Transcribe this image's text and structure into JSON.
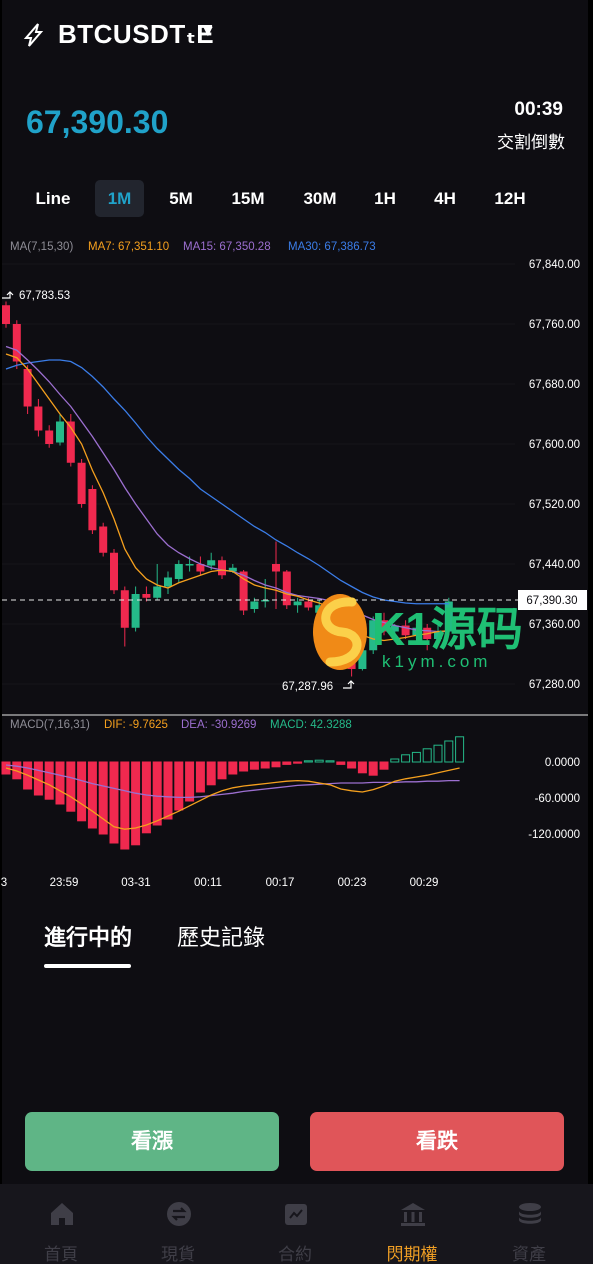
{
  "header": {
    "pair": "BTCUSDTₜE",
    "caret": "▼",
    "price": "67,390.30",
    "countdown": "00:39",
    "countdown_label": "交割倒數"
  },
  "intervals": [
    "Line",
    "1M",
    "5M",
    "15M",
    "30M",
    "1H",
    "4H",
    "12H"
  ],
  "active_interval": "1M",
  "chart": {
    "ma_legend": {
      "label": "MA(7,15,30)",
      "ma7": "MA7: 67,351.10",
      "ma15": "MA15: 67,350.28",
      "ma30": "MA30: 67,386.73"
    },
    "price_axis": [
      "67,840.00",
      "67,760.00",
      "67,680.00",
      "67,600.00",
      "67,520.00",
      "67,440.00",
      "67,360.00",
      "67,280.00"
    ],
    "current_price_tag": "67,390.30",
    "high_label": "67,783.53",
    "low_label": "67,287.96",
    "macd_legend": {
      "label": "MACD(7,16,31)",
      "dif": "DIF: -9.7625",
      "dea": "DEA: -30.9269",
      "macd": "MACD: 42.3288"
    },
    "macd_axis": [
      "0.0000",
      "-60.0000",
      "-120.0000"
    ],
    "time_axis": [
      "3",
      "23:59",
      "03-31",
      "00:11",
      "00:17",
      "00:23",
      "00:29"
    ],
    "watermark": {
      "text": "K1源码",
      "sub": "k1ym.com"
    },
    "colors": {
      "up": "#25b989",
      "down": "#f0294f",
      "ma7": "#f5a01e",
      "ma15": "#9c6fd0",
      "ma30": "#3b7de8"
    }
  },
  "chart_data": {
    "type": "candlestick",
    "y_range": [
      67260,
      67860
    ],
    "candles": [
      {
        "o": 67785,
        "h": 67790,
        "c": 67760,
        "l": 67755
      },
      {
        "o": 67760,
        "h": 67765,
        "c": 67710,
        "l": 67700
      },
      {
        "o": 67700,
        "h": 67705,
        "c": 67650,
        "l": 67640
      },
      {
        "o": 67650,
        "h": 67660,
        "c": 67618,
        "l": 67610
      },
      {
        "o": 67618,
        "h": 67625,
        "c": 67600,
        "l": 67595
      },
      {
        "o": 67602,
        "h": 67640,
        "c": 67630,
        "l": 67598
      },
      {
        "o": 67630,
        "h": 67640,
        "c": 67575,
        "l": 67570
      },
      {
        "o": 67575,
        "h": 67580,
        "c": 67520,
        "l": 67515
      },
      {
        "o": 67540,
        "h": 67545,
        "c": 67485,
        "l": 67480
      },
      {
        "o": 67490,
        "h": 67495,
        "c": 67455,
        "l": 67450
      },
      {
        "o": 67455,
        "h": 67460,
        "c": 67405,
        "l": 67400
      },
      {
        "o": 67405,
        "h": 67410,
        "c": 67355,
        "l": 67330
      },
      {
        "o": 67355,
        "h": 67410,
        "c": 67400,
        "l": 67350
      },
      {
        "o": 67400,
        "h": 67410,
        "c": 67395,
        "l": 67390
      },
      {
        "o": 67395,
        "h": 67440,
        "c": 67410,
        "l": 67392
      },
      {
        "o": 67410,
        "h": 67430,
        "c": 67422,
        "l": 67400
      },
      {
        "o": 67420,
        "h": 67445,
        "c": 67440,
        "l": 67415
      },
      {
        "o": 67440,
        "h": 67450,
        "c": 67440,
        "l": 67430
      },
      {
        "o": 67440,
        "h": 67450,
        "c": 67430,
        "l": 67425
      },
      {
        "o": 67438,
        "h": 67455,
        "c": 67445,
        "l": 67432
      },
      {
        "o": 67445,
        "h": 67450,
        "c": 67425,
        "l": 67420
      },
      {
        "o": 67430,
        "h": 67440,
        "c": 67435,
        "l": 67428
      },
      {
        "o": 67430,
        "h": 67432,
        "c": 67378,
        "l": 67372
      },
      {
        "o": 67380,
        "h": 67395,
        "c": 67390,
        "l": 67375
      },
      {
        "o": 67390,
        "h": 67420,
        "c": 67392,
        "l": 67382
      },
      {
        "o": 67440,
        "h": 67470,
        "c": 67430,
        "l": 67380
      },
      {
        "o": 67430,
        "h": 67432,
        "c": 67385,
        "l": 67380
      },
      {
        "o": 67385,
        "h": 67395,
        "c": 67390,
        "l": 67375
      },
      {
        "o": 67390,
        "h": 67395,
        "c": 67382,
        "l": 67378
      },
      {
        "o": 67375,
        "h": 67392,
        "c": 67385,
        "l": 67370
      },
      {
        "o": 67380,
        "h": 67385,
        "c": 67360,
        "l": 67355
      },
      {
        "o": 67360,
        "h": 67365,
        "c": 67320,
        "l": 67300
      },
      {
        "o": 67320,
        "h": 67330,
        "c": 67300,
        "l": 67290
      },
      {
        "o": 67300,
        "h": 67330,
        "c": 67325,
        "l": 67298
      },
      {
        "o": 67325,
        "h": 67370,
        "c": 67365,
        "l": 67320
      },
      {
        "o": 67365,
        "h": 67375,
        "c": 67350,
        "l": 67345
      },
      {
        "o": 67350,
        "h": 67360,
        "c": 67358,
        "l": 67345
      },
      {
        "o": 67358,
        "h": 67365,
        "c": 67345,
        "l": 67340
      },
      {
        "o": 67345,
        "h": 67360,
        "c": 67355,
        "l": 67340
      },
      {
        "o": 67355,
        "h": 67360,
        "c": 67340,
        "l": 67325
      },
      {
        "o": 67340,
        "h": 67360,
        "c": 67350,
        "l": 67335
      },
      {
        "o": 67350,
        "h": 67395,
        "c": 67390,
        "l": 67345
      }
    ],
    "ma7": [
      67720,
      67715,
      67700,
      67680,
      67660,
      67640,
      67622,
      67600,
      67565,
      67535,
      67500,
      67460,
      67435,
      67420,
      67412,
      67408,
      67415,
      67420,
      67425,
      67430,
      67432,
      67430,
      67420,
      67412,
      67408,
      67405,
      67400,
      67397,
      67392,
      67388,
      67382,
      67370,
      67355,
      67345,
      67340,
      67338,
      67340,
      67342,
      67345,
      67347,
      67350,
      67351
    ],
    "ma15": [
      67730,
      67725,
      67712,
      67698,
      67683,
      67666,
      67650,
      67630,
      67610,
      67588,
      67566,
      67542,
      67520,
      67500,
      67480,
      67465,
      67455,
      67447,
      67440,
      67435,
      67432,
      67430,
      67425,
      67418,
      67412,
      67408,
      67402,
      67398,
      67396,
      67394,
      67391,
      67386,
      67379,
      67372,
      67366,
      67362,
      67358,
      67355,
      67352,
      67351,
      67350,
      67350
    ],
    "ma30": [
      67700,
      67705,
      67708,
      67710,
      67712,
      67712,
      67710,
      67702,
      67690,
      67676,
      67660,
      67645,
      67628,
      67610,
      67594,
      67580,
      67566,
      67554,
      67540,
      67530,
      67520,
      67510,
      67500,
      67490,
      67482,
      67472,
      67464,
      67455,
      67447,
      67438,
      67428,
      67418,
      67410,
      67402,
      67396,
      67392,
      67390,
      67388,
      67387,
      67387,
      67387,
      67387
    ],
    "macd_range": [
      -150,
      50
    ],
    "macd_hist": [
      -20,
      -28,
      -45,
      -55,
      -62,
      -70,
      -82,
      -98,
      -110,
      -120,
      -135,
      -145,
      -138,
      -118,
      -105,
      -95,
      -80,
      -65,
      -50,
      -38,
      -28,
      -20,
      -15,
      -12,
      -10,
      -8,
      -4,
      -2,
      2,
      3,
      2,
      -4,
      -10,
      -18,
      -22,
      -12,
      5,
      12,
      16,
      22,
      28,
      35,
      42
    ],
    "dif": [
      -10,
      -15,
      -22,
      -30,
      -38,
      -48,
      -58,
      -70,
      -82,
      -95,
      -108,
      -112,
      -110,
      -105,
      -98,
      -90,
      -82,
      -73,
      -64,
      -55,
      -48,
      -43,
      -40,
      -38,
      -36,
      -34,
      -32,
      -31,
      -32,
      -35,
      -38,
      -45,
      -48,
      -50,
      -46,
      -40,
      -32,
      -28,
      -25,
      -22,
      -18,
      -14,
      -10
    ],
    "dea": [
      -5,
      -7,
      -10,
      -14,
      -18,
      -22,
      -26,
      -31,
      -36,
      -40,
      -44,
      -48,
      -52,
      -55,
      -57,
      -58,
      -59,
      -59,
      -58,
      -56,
      -54,
      -52,
      -49,
      -47,
      -45,
      -43,
      -41,
      -39,
      -38,
      -37,
      -36,
      -35,
      -35,
      -35,
      -34,
      -34,
      -34,
      -33,
      -33,
      -32,
      -32,
      -31,
      -31
    ]
  },
  "orders": {
    "tab_active": "進行中的",
    "tab_history": "歷史記錄"
  },
  "actions": {
    "up": "看漲",
    "down": "看跌"
  },
  "bottom_nav": [
    {
      "label": "首頁",
      "icon": "home-icon"
    },
    {
      "label": "現貨",
      "icon": "exchange-icon"
    },
    {
      "label": "合約",
      "icon": "contract-icon"
    },
    {
      "label": "閃期權",
      "icon": "bank-icon"
    },
    {
      "label": "資產",
      "icon": "coins-icon"
    }
  ],
  "bottom_nav_active": 3
}
